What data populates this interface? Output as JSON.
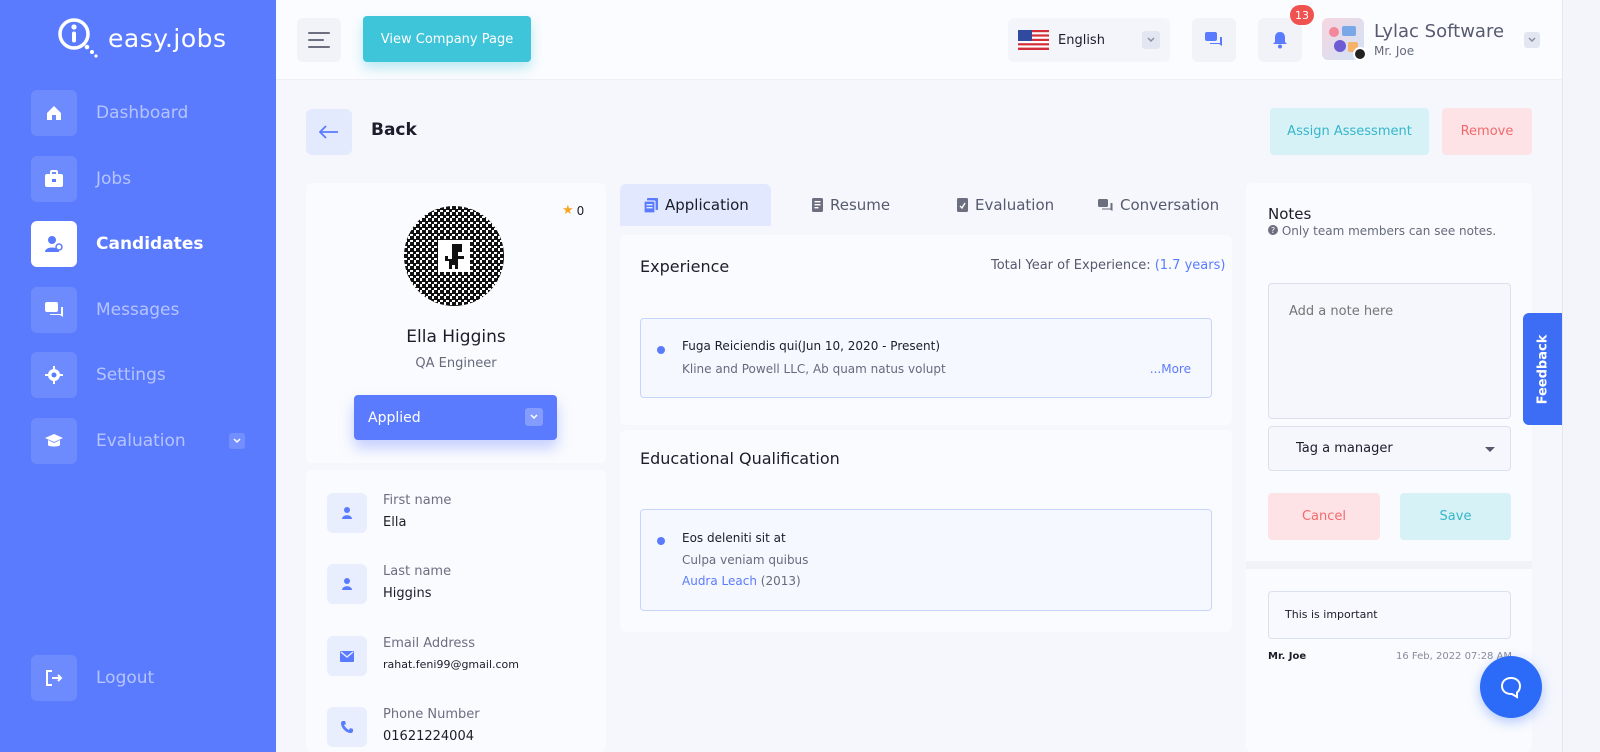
{
  "app": {
    "logo_text": "easy.jobs"
  },
  "sidebar": {
    "items": [
      {
        "label": "Dashboard",
        "icon": "home-icon"
      },
      {
        "label": "Jobs",
        "icon": "briefcase-icon"
      },
      {
        "label": "Candidates",
        "icon": "user-icon",
        "active": true
      },
      {
        "label": "Messages",
        "icon": "chat-icon"
      },
      {
        "label": "Settings",
        "icon": "gear-icon"
      },
      {
        "label": "Evaluation",
        "icon": "graduation-cap-icon"
      }
    ],
    "logout_label": "Logout"
  },
  "topbar": {
    "company_page_button": "View Company Page",
    "language": "English",
    "notification_count": "13",
    "company_name": "Lylac Software",
    "user_name": "Mr. Joe"
  },
  "page": {
    "back_label": "Back",
    "assign_button": "Assign Assessment",
    "remove_button": "Remove"
  },
  "candidate": {
    "rating": "0",
    "name": "Ella Higgins",
    "role": "QA Engineer",
    "status": "Applied",
    "fields": [
      {
        "label": "First name",
        "value": "Ella",
        "icon": "user-icon"
      },
      {
        "label": "Last name",
        "value": "Higgins",
        "icon": "user-icon"
      },
      {
        "label": "Email Address",
        "value": "rahat.feni99@gmail.com",
        "icon": "mail-icon"
      },
      {
        "label": "Phone Number",
        "value": "01621224004",
        "icon": "phone-icon"
      }
    ]
  },
  "tabs": [
    {
      "label": "Application",
      "active": true
    },
    {
      "label": "Resume"
    },
    {
      "label": "Evaluation"
    },
    {
      "label": "Conversation"
    }
  ],
  "experience": {
    "title": "Experience",
    "total_label": "Total Year of Experience:",
    "total_value": "(1.7 years)",
    "entries": [
      {
        "title": "Fuga Reiciendis qui(Jun 10, 2020 - Present)",
        "subtitle": "Kline and Powell LLC, Ab quam natus volupt",
        "more": "...More"
      }
    ]
  },
  "education": {
    "title": "Educational Qualification",
    "entries": [
      {
        "degree": "Eos deleniti sit at",
        "field": "Culpa veniam quibus",
        "institute": "Audra Leach",
        "year": "(2013)"
      }
    ]
  },
  "notes": {
    "title": "Notes",
    "subtitle": "Only team members can see notes.",
    "placeholder": "Add a note here",
    "tag_manager": "Tag a manager",
    "cancel": "Cancel",
    "save": "Save",
    "items": [
      {
        "text": "This is important",
        "author": "Mr. Joe",
        "date": "16 Feb, 2022 07:28 AM"
      }
    ]
  },
  "feedback_label": "Feedback",
  "colors": {
    "primary": "#5b7bfe",
    "accent_teal": "#3ec5d9",
    "danger": "#f26a6d"
  }
}
